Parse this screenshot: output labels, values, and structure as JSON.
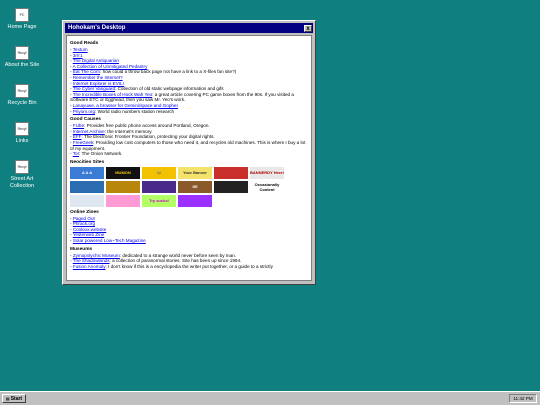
{
  "desktop_icons": [
    {
      "icon_text": "PC",
      "label": "Home Page"
    },
    {
      "icon_text": "Recyl",
      "label": "About the Site"
    },
    {
      "icon_text": "Recyl",
      "label": "Recycle Bin"
    },
    {
      "icon_text": "Recyl",
      "label": "Links"
    },
    {
      "icon_text": "Recyl",
      "label": "Street Art Collection"
    }
  ],
  "window": {
    "title": "Hohokam's Desktop",
    "close_label": "x"
  },
  "good_reads": {
    "heading": "Good Reads",
    "items": [
      {
        "link": "Textum",
        "text": ""
      },
      {
        "link": "3rrr1",
        "text": ""
      },
      {
        "link": "The Digital Antiquarian",
        "text": ""
      },
      {
        "link": "A Collection of Unmitigated Pedantry",
        "text": ""
      },
      {
        "link": "Eat The Corn",
        "text": ": how could a throw back page not have a link to a X-files fan site?)"
      },
      {
        "link": "Remember the Internet?",
        "text": ""
      },
      {
        "link": "Internet Explorer is EVIL!",
        "text": ""
      },
      {
        "link": "The Cyber Vanguard",
        "text": ": Collection of old static webpage information and gifs"
      },
      {
        "link": "The Incredible Boxes of Hock Wah Yeo",
        "text": ": a great article covering PC game boxes from the 90s. If you visited a Software ETC or Egghead, then you saw Mr. Yeo's work."
      },
      {
        "link": "Lanayuwe, a browser for Gemini/space and Gopher",
        "text": ""
      },
      {
        "link": "Priyom.org",
        "text": ": World radio numbers station research"
      }
    ]
  },
  "good_causes": {
    "heading": "Good Causes",
    "items": [
      {
        "link": "FUbe",
        "text": ": Provides free public phone access around Portland, Oregon."
      },
      {
        "link": "Internet Archive",
        "text": ": the Internet's memory."
      },
      {
        "link": "EFF",
        "text": ": The Electronic Frontier Foundation, protecting your digital rights."
      },
      {
        "link": "FreeGeek",
        "text": ": Providing low cost computers to those who need it, and recycles old machines. This is where I buy a lot of my equipment."
      },
      {
        "link": "Tor",
        "text": ": The Onion Network."
      }
    ]
  },
  "neocities": {
    "heading": "Neocities Sites",
    "badges": [
      {
        "label": "A A A",
        "bg": "#3a7bd5",
        "fg": "#ffffff"
      },
      {
        "label": "MUMON",
        "bg": "#111111",
        "fg": "#ffcc00"
      },
      {
        "label": "🐝",
        "bg": "#f2c200",
        "fg": "#000000"
      },
      {
        "label": "Your Banner",
        "bg": "#f3e36b",
        "fg": "#333333"
      },
      {
        "label": "",
        "bg": "#c9302c",
        "fg": "#ffffff"
      },
      {
        "label": "BANNERDY Here!",
        "bg": "#e8e8e8",
        "fg": "#aa0000"
      },
      {
        "label": "",
        "bg": "#2b6cb0",
        "fg": "#ffffff"
      },
      {
        "label": "",
        "bg": "#b8860b",
        "fg": "#ffffff"
      },
      {
        "label": "",
        "bg": "#4b2b8a",
        "fg": "#ffffff"
      },
      {
        "label": "SE",
        "bg": "#8b5a2b",
        "fg": "#ffffff"
      },
      {
        "label": "",
        "bg": "#222222",
        "fg": "#ffffff"
      },
      {
        "label": "Occasionally Content",
        "bg": "#ffffff",
        "fg": "#000000"
      },
      {
        "label": "",
        "bg": "#dfe8f0",
        "fg": "#333333"
      },
      {
        "label": "",
        "bg": "#ff9ad5",
        "fg": "#333333"
      },
      {
        "label": "Try sucks!",
        "bg": "#b3ff66",
        "fg": "#cc00cc"
      },
      {
        "label": "",
        "bg": "#9b30ff",
        "fg": "#ffffff"
      }
    ]
  },
  "online_zines": {
    "heading": "Online Zines",
    "items": [
      {
        "link": "Paged Out",
        "text": ""
      },
      {
        "link": "Phrack.org",
        "text": ""
      },
      {
        "link": "Cookiux.website",
        "text": ""
      },
      {
        "link": "Yesterweb Zine",
        "text": ""
      },
      {
        "link": "Solar powered Low~Tech Magazine",
        "text": ""
      }
    ]
  },
  "museums": {
    "heading": "Museums",
    "items": [
      {
        "link": "Zymopolychic Museum",
        "text": ": dedicated to a strange world never before seen by man."
      },
      {
        "link": "The Shadowlands",
        "text": ": a collection of paranormal stories. Site has been up since 1994."
      },
      {
        "link": "Fusion Anomaly",
        "text": ": I don't know if this is a encyclopedia the writer put together, or a guide to a strictly"
      }
    ]
  },
  "taskbar": {
    "start_label": "Start",
    "clock": "11:42 PM"
  },
  "colors": {
    "desktop": "#0f7f7f",
    "titlebar": "#000080",
    "link": "#0000ee"
  }
}
